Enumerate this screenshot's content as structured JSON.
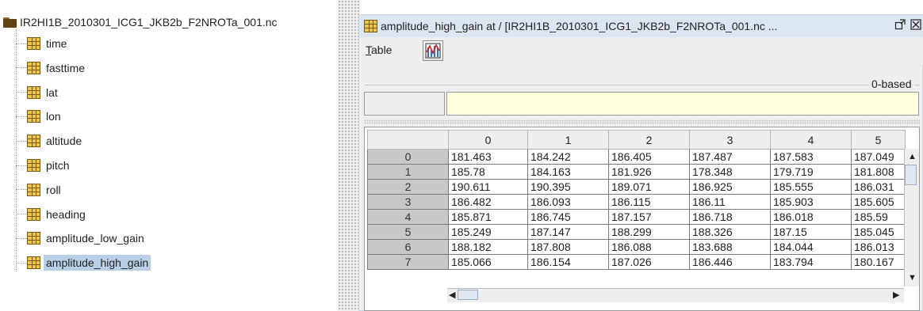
{
  "tree": {
    "root_label": "IR2HI1B_2010301_ICG1_JKB2b_F2NROTa_001.nc",
    "items": [
      {
        "label": "time",
        "selected": false
      },
      {
        "label": "fasttime",
        "selected": false
      },
      {
        "label": "lat",
        "selected": false
      },
      {
        "label": "lon",
        "selected": false
      },
      {
        "label": "altitude",
        "selected": false
      },
      {
        "label": "pitch",
        "selected": false
      },
      {
        "label": "roll",
        "selected": false
      },
      {
        "label": "heading",
        "selected": false
      },
      {
        "label": "amplitude_low_gain",
        "selected": false
      },
      {
        "label": "amplitude_high_gain",
        "selected": true
      }
    ]
  },
  "window": {
    "title": "amplitude_high_gain  at  / [IR2HI1B_2010301_ICG1_JKB2b_F2NROTa_001.nc ...",
    "restore_icon": "restore-icon",
    "close_icon": "close-icon"
  },
  "menu": {
    "table_label": "Table",
    "table_mnemonic": "T",
    "table_rest": "able",
    "chart_icon": "line-chart-icon"
  },
  "index_panel": {
    "mode_label": "0-based",
    "input_value": ""
  },
  "table": {
    "columns": [
      "0",
      "1",
      "2",
      "3",
      "4",
      "5"
    ],
    "rows": [
      {
        "index": "0",
        "cells": [
          "181.463",
          "184.242",
          "186.405",
          "187.487",
          "187.583",
          "187.049"
        ]
      },
      {
        "index": "1",
        "cells": [
          "185.78",
          "184.163",
          "181.926",
          "178.348",
          "179.719",
          "181.808"
        ]
      },
      {
        "index": "2",
        "cells": [
          "190.611",
          "190.395",
          "189.071",
          "186.925",
          "185.555",
          "186.031"
        ]
      },
      {
        "index": "3",
        "cells": [
          "186.482",
          "186.093",
          "186.115",
          "186.11",
          "185.903",
          "185.605"
        ]
      },
      {
        "index": "4",
        "cells": [
          "185.871",
          "186.745",
          "187.157",
          "186.718",
          "186.018",
          "185.59"
        ]
      },
      {
        "index": "5",
        "cells": [
          "185.249",
          "187.147",
          "188.299",
          "188.326",
          "187.15",
          "185.045"
        ]
      },
      {
        "index": "6",
        "cells": [
          "188.182",
          "187.808",
          "186.088",
          "183.688",
          "184.044",
          "186.013"
        ]
      },
      {
        "index": "7",
        "cells": [
          "185.066",
          "186.154",
          "187.026",
          "186.446",
          "183.794",
          "180.167"
        ]
      }
    ]
  },
  "colors": {
    "selection": "#b8cfe5",
    "titlebar": "#dce6f1",
    "input_bg": "#ffffe0",
    "row_header": "#c8c8c8"
  }
}
